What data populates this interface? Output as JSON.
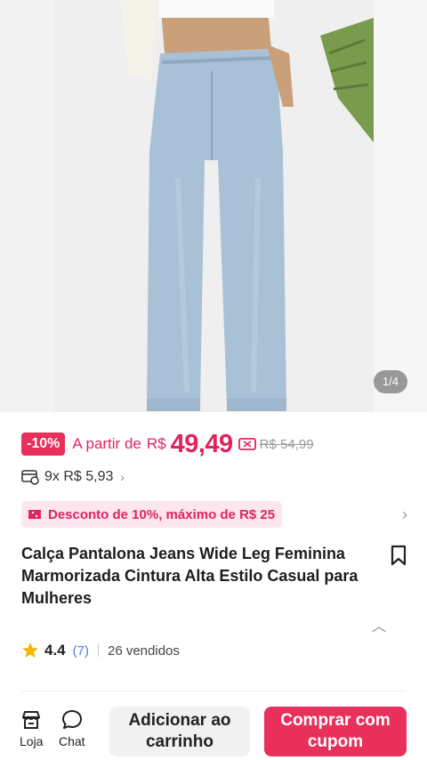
{
  "gallery": {
    "counter": "1/4"
  },
  "price": {
    "discount_badge": "-10%",
    "from_label": "A partir de",
    "currency": "R$",
    "amount": "49,49",
    "original": "R$ 54,99"
  },
  "installment": {
    "text": "9x R$ 5,93"
  },
  "promo": {
    "text": "Desconto de 10%, máximo de R$ 25"
  },
  "product": {
    "title": "Calça Pantalona Jeans Wide Leg Feminina Marmorizada Cintura Alta Estilo Casual para Mulheres"
  },
  "rating": {
    "value": "4.4",
    "count": "(7)",
    "sold": "26 vendidos"
  },
  "bottom_bar": {
    "store_label": "Loja",
    "chat_label": "Chat",
    "add_to_cart_line1": "Adicionar ao",
    "add_to_cart_line2": "carrinho",
    "buy_line1": "Comprar com",
    "buy_line2": "cupom"
  },
  "colors": {
    "accent": "#e8305a",
    "promo_bg": "#fde6ee"
  },
  "icons": [
    "coupon-icon",
    "card-icon",
    "promo-icon",
    "bookmark-icon",
    "star-icon",
    "store-icon",
    "chat-icon",
    "chevron-right-icon",
    "chevron-up-icon"
  ]
}
